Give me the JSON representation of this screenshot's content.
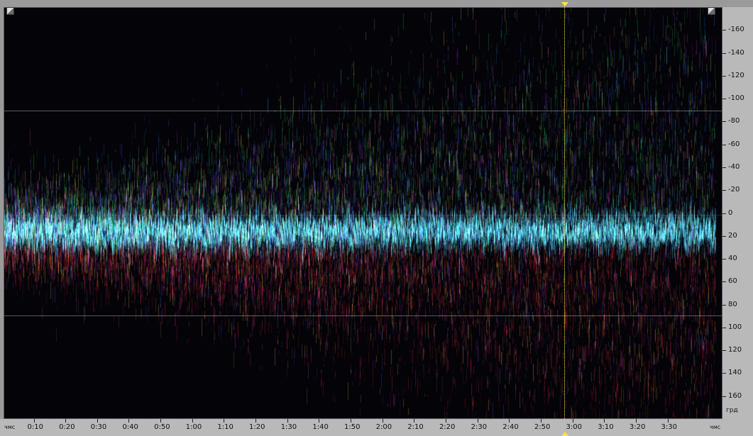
{
  "x_axis": {
    "unit_left": "чмс",
    "unit_right": "чмс",
    "labels": [
      "0:10",
      "0:20",
      "0:30",
      "0:40",
      "0:50",
      "1:00",
      "1:10",
      "1:20",
      "1:30",
      "1:40",
      "1:50",
      "2:00",
      "2:10",
      "2:20",
      "2:30",
      "2:40",
      "2:50",
      "3:00",
      "3:10",
      "3:20",
      "3:30"
    ]
  },
  "y_axis": {
    "unit": "грд",
    "labels": [
      "-160",
      "-140",
      "-120",
      "-100",
      "-80",
      "-60",
      "-40",
      "-20",
      "0",
      "20",
      "40",
      "60",
      "80",
      "100",
      "120",
      "140",
      "160"
    ]
  },
  "colors": {
    "background": "#030308",
    "cursor": "#ffe24a",
    "axis_panel": "#b9b9b9",
    "core_band": "#5fd0e8"
  },
  "chart_data": {
    "type": "heatmap",
    "x_range_seconds": [
      0,
      225
    ],
    "y_range_degrees": [
      -180,
      180
    ],
    "y_direction": "down-positive",
    "core_band_center_degrees": 15,
    "guide_lines_degrees": [
      -90,
      90
    ],
    "cursor_time": "2:58"
  }
}
